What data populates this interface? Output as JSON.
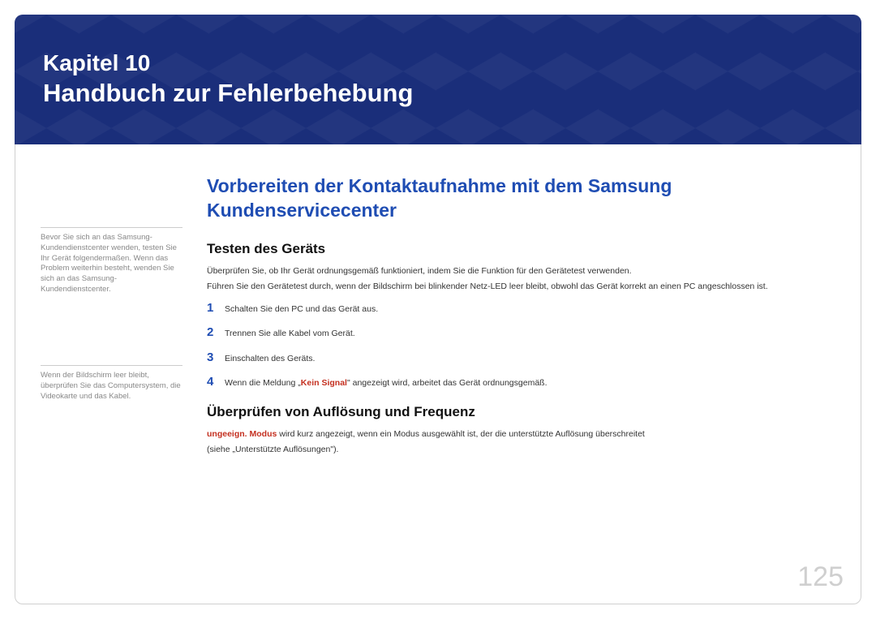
{
  "chapter": {
    "label": "Kapitel 10",
    "title": "Handbuch zur Fehlerbehebung"
  },
  "sidebar": {
    "note1": "Bevor Sie sich an das Samsung-Kundendienstcenter wenden, testen Sie Ihr Gerät folgendermaßen. Wenn das Problem weiterhin besteht, wenden Sie sich an das Samsung-Kundendienstcenter.",
    "note2": "Wenn der Bildschirm leer bleibt, überprüfen Sie das Computersystem, die Videokarte und das Kabel."
  },
  "main": {
    "heading": "Vorbereiten der Kontaktaufnahme mit dem Samsung Kundenservicecenter",
    "section1": {
      "title": "Testen des Geräts",
      "para1": "Überprüfen Sie, ob Ihr Gerät ordnungsgemäß funktioniert, indem Sie die Funktion für den Gerätetest verwenden.",
      "para2": "Führen Sie den Gerätetest durch, wenn der Bildschirm bei blinkender Netz-LED leer bleibt, obwohl das Gerät korrekt an einen PC angeschlossen ist.",
      "steps": [
        {
          "n": "1",
          "text": "Schalten Sie den PC und das Gerät aus."
        },
        {
          "n": "2",
          "text": "Trennen Sie alle Kabel vom Gerät."
        },
        {
          "n": "3",
          "text": "Einschalten des Geräts."
        },
        {
          "n": "4",
          "prefix": "Wenn die Meldung „",
          "signal": "Kein Signal",
          "suffix": "\" angezeigt wird, arbeitet das Gerät ordnungsgemäß."
        }
      ]
    },
    "section2": {
      "title": "Überprüfen von Auflösung und Frequenz",
      "mode_label": "ungeeign. Modus",
      "mode_rest": " wird kurz angezeigt, wenn ein Modus ausgewählt ist, der die unterstützte Auflösung überschreitet",
      "para2": "(siehe „Unterstützte Auflösungen\")."
    }
  },
  "page_number": "125"
}
